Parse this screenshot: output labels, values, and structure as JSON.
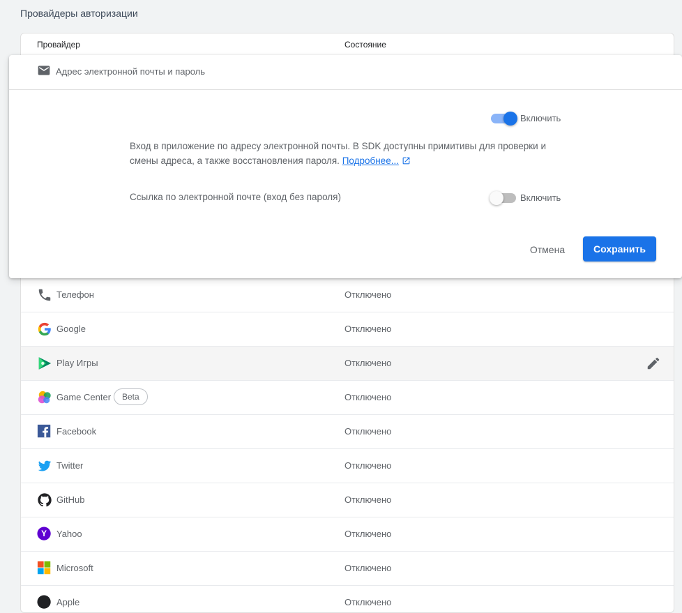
{
  "section_title": "Провайдеры авторизации",
  "table": {
    "col_provider": "Провайдер",
    "col_state": "Состояние"
  },
  "email_panel": {
    "title": "Адрес электронной почты и пароль",
    "enable_label": "Включить",
    "enable_on": true,
    "description": "Вход в приложение по адресу электронной почты. В SDK доступны примитивы для проверки и смены адреса, а также восстановления пароля.",
    "learn_more": "Подробнее...",
    "email_link_label": "Ссылка по электронной почте (вход без пароля)",
    "email_link_enable_label": "Включить",
    "email_link_on": false,
    "cancel": "Отмена",
    "save": "Сохранить"
  },
  "providers": [
    {
      "name": "Телефон",
      "state": "Отключено",
      "icon": "phone-icon"
    },
    {
      "name": "Google",
      "state": "Отключено",
      "icon": "google-icon"
    },
    {
      "name": "Play Игры",
      "state": "Отключено",
      "icon": "play-games-icon"
    },
    {
      "name": "Game Center",
      "state": "Отключено",
      "icon": "game-center-icon",
      "badge": "Beta"
    },
    {
      "name": "Facebook",
      "state": "Отключено",
      "icon": "facebook-icon"
    },
    {
      "name": "Twitter",
      "state": "Отключено",
      "icon": "twitter-icon"
    },
    {
      "name": "GitHub",
      "state": "Отключено",
      "icon": "github-icon"
    },
    {
      "name": "Yahoo",
      "state": "Отключено",
      "icon": "yahoo-icon"
    },
    {
      "name": "Microsoft",
      "state": "Отключено",
      "icon": "microsoft-icon"
    },
    {
      "name": "Apple",
      "state": "Отключено",
      "icon": "apple-icon"
    }
  ],
  "colors": {
    "accent": "#1a73e8",
    "facebook": "#3b5998",
    "twitter": "#1da1f2",
    "yahoo": "#5f01d1"
  }
}
